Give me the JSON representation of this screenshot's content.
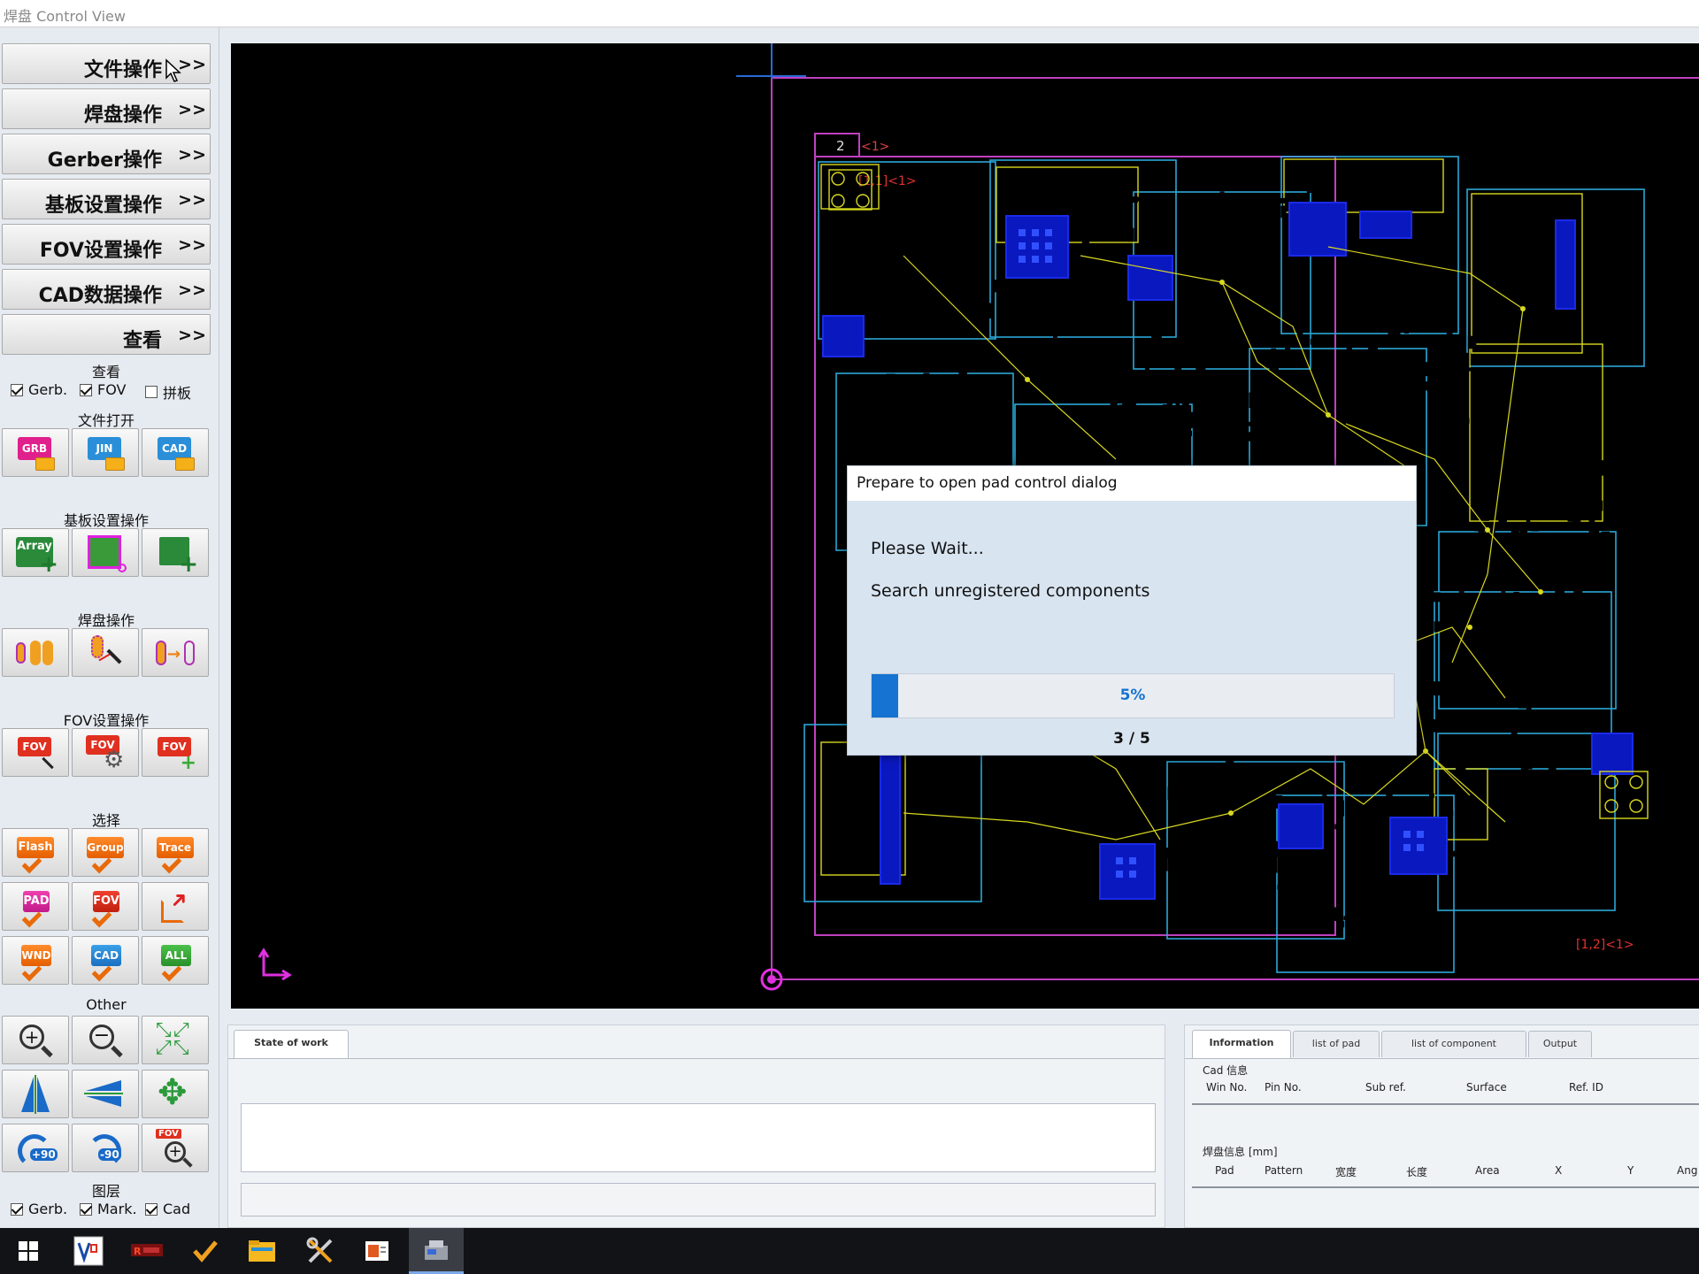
{
  "window": {
    "title": "焊盘 Control View"
  },
  "menu": [
    {
      "label": "文件操作",
      "arrow": ">>"
    },
    {
      "label": "焊盘操作",
      "arrow": ">>"
    },
    {
      "label": "Gerber操作",
      "arrow": ">>"
    },
    {
      "label": "基板设置操作",
      "arrow": ">>"
    },
    {
      "label": "FOV设置操作",
      "arrow": ">>"
    },
    {
      "label": "CAD数据操作",
      "arrow": ">>"
    },
    {
      "label": "查看",
      "arrow": ">>"
    }
  ],
  "sections": {
    "view": "查看",
    "file_open": "文件打开",
    "board": "基板设置操作",
    "pad": "焊盘操作",
    "fov": "FOV设置操作",
    "select": "选择",
    "other": "Other",
    "layer": "图层"
  },
  "view_checks": [
    {
      "label": "Gerb.",
      "checked": true
    },
    {
      "label": "FOV",
      "checked": true
    },
    {
      "label": "拼板",
      "checked": false
    }
  ],
  "layer_checks": [
    {
      "label": "Gerb.",
      "checked": true
    },
    {
      "label": "Mark.",
      "checked": true
    },
    {
      "label": "Cad",
      "checked": true
    }
  ],
  "file_tools": [
    {
      "label": "GRB",
      "icon": "open-gerber-icon",
      "color": "#e0208c"
    },
    {
      "label": "JIN",
      "icon": "open-jin-icon",
      "color": "#2a8fd8"
    },
    {
      "label": "CAD",
      "icon": "open-cad-icon",
      "color": "#2a8fd8"
    }
  ],
  "board_tools": [
    {
      "label": "Array",
      "icon": "array-add-icon"
    },
    {
      "icon": "board-origin-icon"
    },
    {
      "icon": "board-add-icon"
    }
  ],
  "pad_tools": [
    {
      "icon": "pad-group-icon"
    },
    {
      "icon": "pad-select-icon"
    },
    {
      "icon": "pad-convert-icon"
    }
  ],
  "fov_tools": [
    {
      "label": "FOV",
      "icon": "fov-select-icon"
    },
    {
      "label": "FOV",
      "icon": "fov-settings-icon"
    },
    {
      "label": "FOV",
      "icon": "fov-add-icon"
    }
  ],
  "select_tools": [
    {
      "label": "Flash",
      "icon": "select-flash-icon"
    },
    {
      "label": "Group",
      "icon": "select-group-icon"
    },
    {
      "label": "Trace",
      "icon": "select-trace-icon"
    },
    {
      "label": "PAD",
      "icon": "select-pad-icon"
    },
    {
      "label": "FOV",
      "icon": "select-fov-icon"
    },
    {
      "icon": "export-icon"
    },
    {
      "label": "WND",
      "icon": "select-window-icon"
    },
    {
      "label": "CAD",
      "icon": "select-cad-icon"
    },
    {
      "label": "ALL",
      "icon": "select-all-icon"
    }
  ],
  "other_tools": [
    {
      "icon": "zoom-in-icon"
    },
    {
      "icon": "zoom-out-icon"
    },
    {
      "icon": "fit-view-icon"
    },
    {
      "icon": "mirror-y-icon"
    },
    {
      "icon": "mirror-x-icon"
    },
    {
      "icon": "move-icon"
    },
    {
      "label": "+90",
      "icon": "rotate-plus-90-icon"
    },
    {
      "label": "-90",
      "icon": "rotate-minus-90-icon"
    },
    {
      "label": "FOV",
      "icon": "fov-zoom-icon"
    }
  ],
  "canvas": {
    "board_id": "2",
    "board_tag": "<1>",
    "corner_top": "[1,1]<1>",
    "corner_bottom": "[1,2]<1>",
    "colors": {
      "background": "#000000",
      "board": "#c040c0",
      "fov": "#2aa8d8",
      "pad": "#d8d820",
      "cad": "#1a2ae8"
    }
  },
  "dialog": {
    "title": "Prepare to open pad control dialog",
    "line1": "Please Wait...",
    "line2": "Search unregistered components",
    "progress": 5,
    "progress_text": "5%",
    "step": "3 / 5"
  },
  "state_panel": {
    "tab": "State of work"
  },
  "info_panel": {
    "tabs": [
      "Information",
      "list of pad",
      "list of component",
      "Output"
    ],
    "cad_header": "Cad 信息",
    "cad_columns": [
      "Win No.",
      "Pin No.",
      "Sub ref.",
      "Surface",
      "Ref. ID"
    ],
    "pad_header": "焊盘信息 [mm]",
    "pad_columns": [
      "Pad",
      "Pattern",
      "宽度",
      "长度",
      "Area",
      "X",
      "Y",
      "Ang"
    ]
  },
  "taskbar": [
    {
      "icon": "windows-start-icon"
    },
    {
      "icon": "vb-app-icon"
    },
    {
      "icon": "red-app-icon"
    },
    {
      "icon": "check-app-icon"
    },
    {
      "icon": "file-explorer-icon"
    },
    {
      "icon": "tools-app-icon"
    },
    {
      "icon": "office-app-icon"
    },
    {
      "icon": "machine-app-icon"
    }
  ]
}
